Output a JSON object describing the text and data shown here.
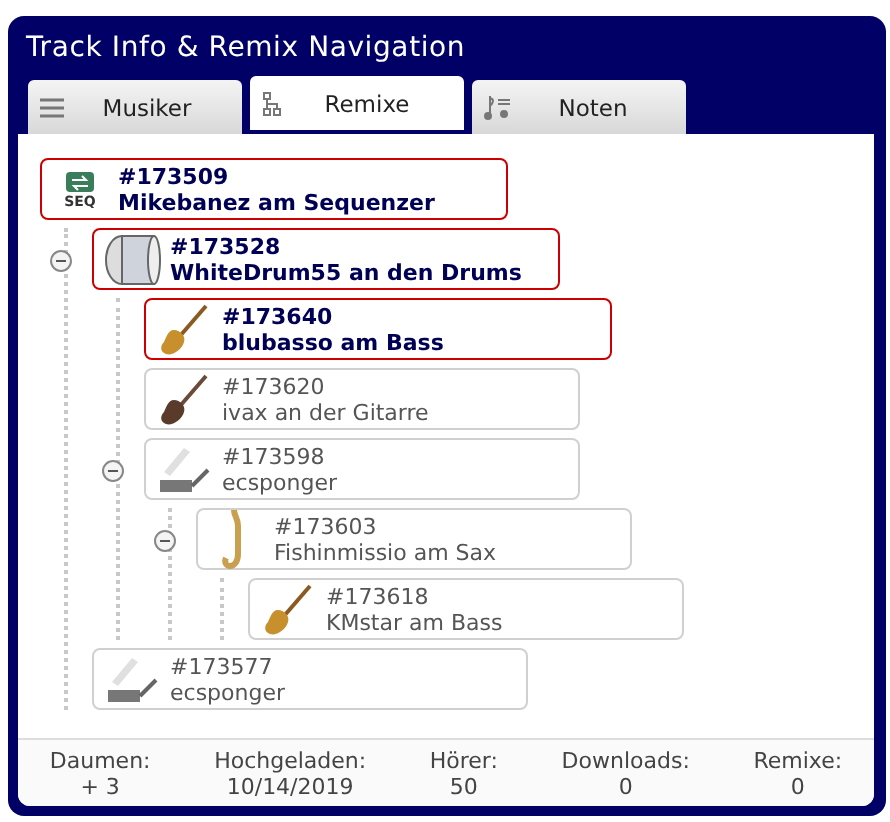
{
  "window": {
    "title": "Track Info & Remix Navigation"
  },
  "tabs": [
    {
      "label": "Musiker",
      "kind": "menu",
      "selected": false
    },
    {
      "label": "Remixe",
      "kind": "tree",
      "selected": true
    },
    {
      "label": "Noten",
      "kind": "notes",
      "selected": false
    }
  ],
  "tree": [
    {
      "id": "#173509",
      "title": "Mikebanez am Sequenzer",
      "kind": "sequencer",
      "icon_label": "SEQ",
      "highlighted": true,
      "children": [
        {
          "id": "#173528",
          "title": "WhiteDrum55 an den Drums",
          "kind": "drum",
          "highlighted": true,
          "expanded": true,
          "children": [
            {
              "id": "#173640",
              "title": "blubasso am Bass",
              "kind": "bass",
              "highlighted": true
            },
            {
              "id": "#173620",
              "title": "ivax an der Gitarre",
              "kind": "guitar",
              "highlighted": false
            },
            {
              "id": "#173598",
              "title": "ecsponger",
              "kind": "keys",
              "highlighted": false,
              "expanded": true,
              "children": [
                {
                  "id": "#173603",
                  "title": "Fishinmissio am Sax",
                  "kind": "sax",
                  "highlighted": false,
                  "expanded": true,
                  "children": [
                    {
                      "id": "#173618",
                      "title": "KMstar am Bass",
                      "kind": "bass",
                      "highlighted": false
                    }
                  ]
                }
              ]
            }
          ]
        },
        {
          "id": "#173577",
          "title": "ecsponger",
          "kind": "keys",
          "highlighted": false
        }
      ]
    }
  ],
  "stats": [
    {
      "label": "Daumen:",
      "value": "+ 3"
    },
    {
      "label": "Hochgeladen:",
      "value": "10/14/2019"
    },
    {
      "label": "Hörer:",
      "value": "50"
    },
    {
      "label": "Downloads:",
      "value": "0"
    },
    {
      "label": "Remixe:",
      "value": "0"
    }
  ]
}
